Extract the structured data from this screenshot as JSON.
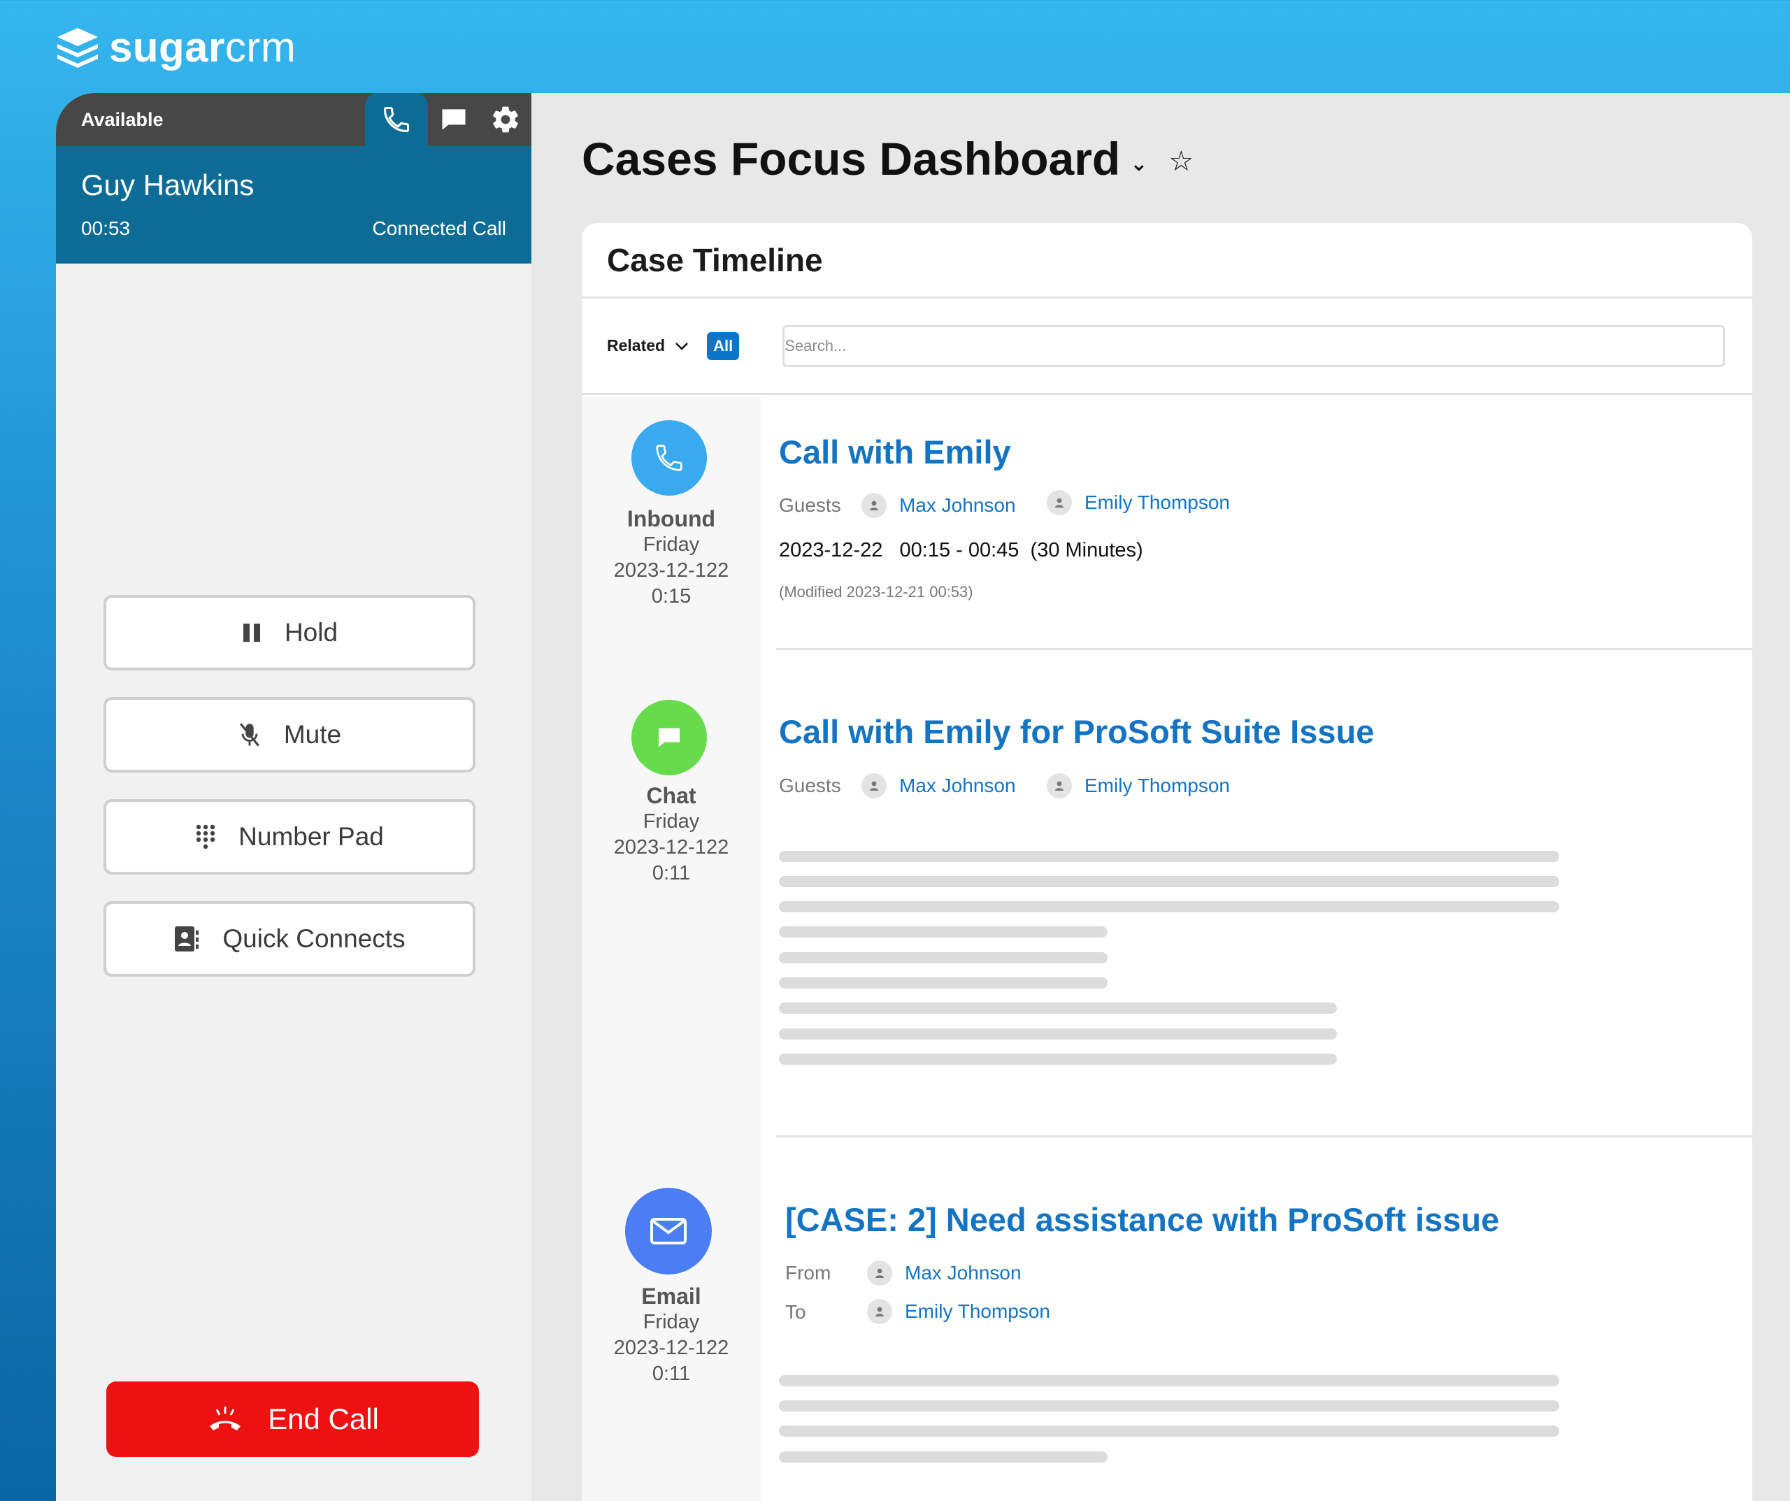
{
  "brand": {
    "sugar": "sugar",
    "crm": "crm"
  },
  "phone": {
    "status": "Available",
    "caller_name": "Guy Hawkins",
    "timer": "00:53",
    "call_state": "Connected Call",
    "actions": {
      "hold": "Hold",
      "mute": "Mute",
      "number_pad": "Number Pad",
      "quick_connects": "Quick Connects"
    },
    "end_call": "End Call"
  },
  "dashboard": {
    "title": "Cases Focus Dashboard",
    "card_title": "Case Timeline",
    "filter": {
      "related_label": "Related",
      "all_badge": "All",
      "search_placeholder": "Search..."
    },
    "entries": [
      {
        "kind": "Inbound",
        "day": "Friday",
        "date": "2023-12-122",
        "time": "0:15",
        "title": "Call with Emily",
        "guests_label": "Guests",
        "guests": [
          "Max Johnson",
          "Emily Thompson"
        ],
        "when": "2023-12-22   00:15 - 00:45  (30 Minutes)",
        "modified": "(Modified 2023-12-21 00:53)"
      },
      {
        "kind": "Chat",
        "day": "Friday",
        "date": "2023-12-122",
        "time": "0:11",
        "title": "Call with Emily for ProSoft Suite Issue",
        "guests_label": "Guests",
        "guests": [
          "Max Johnson",
          "Emily Thompson"
        ]
      },
      {
        "kind": "Email",
        "day": "Friday",
        "date": "2023-12-122",
        "time": "0:11",
        "title": "[CASE: 2] Need assistance with ProSoft issue",
        "from_label": "From",
        "from": "Max Johnson",
        "to_label": "To",
        "to": "Emily Thompson"
      }
    ]
  },
  "colors": {
    "header_gradient_top": "#35b6ee",
    "phone_dark": "#474747",
    "phone_teal": "#0d6c96",
    "link_blue": "#1474c4",
    "end_call_red": "#ee1111",
    "inbound_icon": "#3aaaf0",
    "chat_icon": "#67dc4b",
    "email_icon": "#4b7ef2"
  },
  "icons": {
    "logo": "sugar-stack-icon",
    "phone_tab": "phone-icon",
    "chat_tab": "chat-icon",
    "settings_tab": "gear-icon",
    "hold": "pause-icon",
    "mute": "mic-off-icon",
    "number_pad": "dialpad-icon",
    "quick_connects": "contact-book-icon",
    "end_call": "hangup-icon"
  }
}
